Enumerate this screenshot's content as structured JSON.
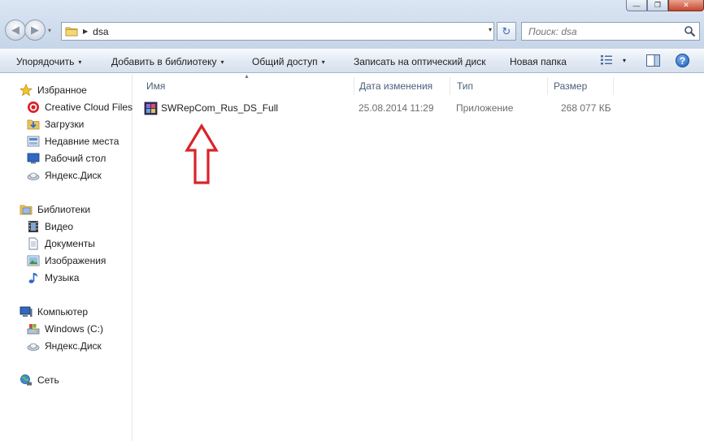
{
  "window": {
    "minimize_glyph": "—",
    "maximize_glyph": "❐",
    "close_glyph": "✕"
  },
  "address_bar": {
    "path_segment": "dsa",
    "folder_icon": "folder-icon",
    "separator_glyph": "▶",
    "dropdown_glyph": "▾"
  },
  "search": {
    "placeholder": "Поиск: dsa",
    "icon": "search-icon"
  },
  "navigation": {
    "back_glyph": "◀",
    "forward_glyph": "▶",
    "history_glyph": "▾",
    "refresh_glyph": "↻"
  },
  "toolbar": {
    "organize": "Упорядочить",
    "add_to_library": "Добавить в библиотеку",
    "share": "Общий доступ",
    "burn": "Записать на оптический диск",
    "new_folder": "Новая папка",
    "caret": "▾",
    "help": "?"
  },
  "nav_pane": {
    "favorites": {
      "label": "Избранное",
      "items": [
        "Creative Cloud Files",
        "Загрузки",
        "Недавние места",
        "Рабочий стол",
        "Яндекс.Диск"
      ]
    },
    "libraries": {
      "label": "Библиотеки",
      "items": [
        "Видео",
        "Документы",
        "Изображения",
        "Музыка"
      ]
    },
    "computer": {
      "label": "Компьютер",
      "items": [
        "Windows (C:)",
        "Яндекс.Диск"
      ]
    },
    "network": {
      "label": "Сеть"
    }
  },
  "file_list": {
    "columns": [
      "Имя",
      "Дата изменения",
      "Тип",
      "Размер"
    ],
    "sort_indicator": "▲",
    "rows": [
      {
        "name": "SWRepCom_Rus_DS_Full",
        "modified": "25.08.2014 11:29",
        "type": "Приложение",
        "size": "268 077 КБ"
      }
    ]
  },
  "colors": {
    "annotation_arrow": "#d9242a",
    "toolbar_bg": "#dfe8f3",
    "selection_border": "#c9d9ee"
  }
}
